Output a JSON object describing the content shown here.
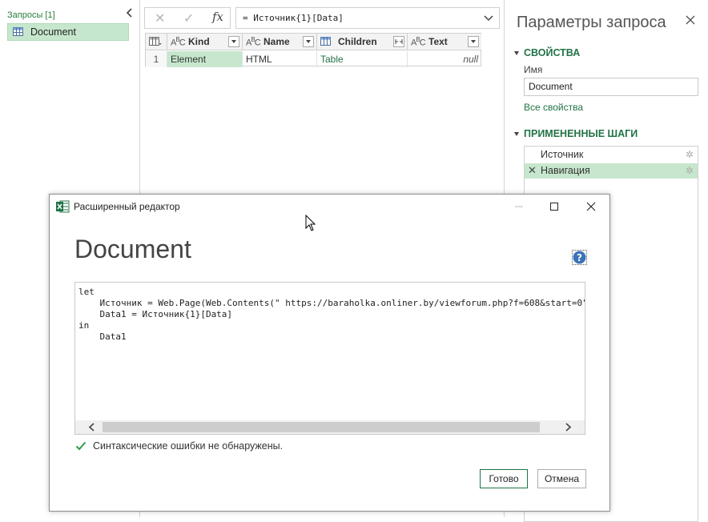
{
  "queries_pane": {
    "title": "Запросы [1]",
    "items": [
      {
        "label": "Document",
        "icon": "table-icon"
      }
    ]
  },
  "formula_bar": {
    "fx_label": "fx",
    "formula": "= Источник{1}[Data]"
  },
  "preview_table": {
    "columns": [
      {
        "type_label": "ABC",
        "name": "Kind"
      },
      {
        "type_label": "ABC",
        "name": "Name"
      },
      {
        "type_label": "table",
        "name": "Children"
      },
      {
        "type_label": "ABC",
        "name": "Text"
      }
    ],
    "rows": [
      {
        "index": "1",
        "kind": "Element",
        "name": "HTML",
        "children": "Table",
        "text": "null"
      }
    ]
  },
  "query_settings": {
    "title": "Параметры запроса",
    "properties_title": "СВОЙСТВА",
    "name_label": "Имя",
    "name_value": "Document",
    "all_properties_link": "Все свойства",
    "steps_title": "ПРИМЕНЕННЫЕ ШАГИ",
    "steps": [
      {
        "label": "Источник",
        "selected": false
      },
      {
        "label": "Навигация",
        "selected": true
      }
    ]
  },
  "advanced_editor": {
    "window_title": "Расширенный редактор",
    "heading": "Document",
    "code_lines": [
      "let",
      "    Источник = Web.Page(Web.Contents(\" https://baraholka.onliner.by/viewforum.php?f=608&start=0\"",
      "    Data1 = Источник{1}[Data]",
      "in",
      "    Data1"
    ],
    "status": "Синтаксические ошибки не обнаружены.",
    "ok_label": "Готово",
    "cancel_label": "Отмена"
  },
  "colors": {
    "accent": "#217346",
    "selection": "#c6e7cd"
  }
}
